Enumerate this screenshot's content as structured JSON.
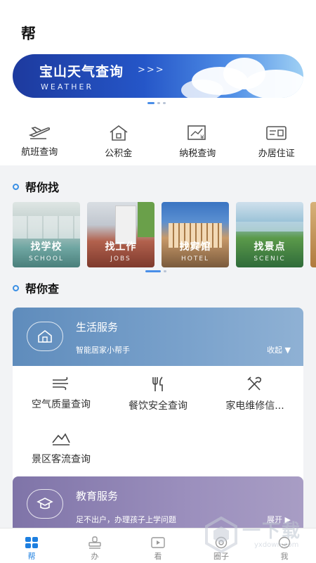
{
  "header": {
    "title": "帮"
  },
  "banner": {
    "title": "宝山天气查询",
    "arrows": ">>>",
    "subtitle": "WEATHER"
  },
  "quick_services": [
    {
      "label": "航班查询",
      "icon": "airplane-icon"
    },
    {
      "label": "公积金",
      "icon": "house-icon"
    },
    {
      "label": "纳税查询",
      "icon": "tax-chart-icon"
    },
    {
      "label": "办居住证",
      "icon": "id-card-icon"
    }
  ],
  "find_section": {
    "title": "帮你找",
    "items": [
      {
        "cn": "找学校",
        "en": "SCHOOL"
      },
      {
        "cn": "找工作",
        "en": "JOBS"
      },
      {
        "cn": "找宾馆",
        "en": "HOTEL"
      },
      {
        "cn": "找景点",
        "en": "SCENIC"
      }
    ]
  },
  "check_section": {
    "title": "帮你查"
  },
  "life_card": {
    "title": "生活服务",
    "subtitle": "智能居家小帮手",
    "collapse_label": "收起 ▼",
    "items": [
      {
        "label": "空气质量查询",
        "icon": "wind-icon"
      },
      {
        "label": "餐饮安全查询",
        "icon": "cutlery-icon"
      },
      {
        "label": "家电维修信...",
        "icon": "tools-icon"
      },
      {
        "label": "景区客流查询",
        "icon": "mountain-icon"
      }
    ]
  },
  "edu_card": {
    "title": "教育服务",
    "subtitle": "足不出户，办理孩子上学问题",
    "expand_label": "展开 ▶"
  },
  "tabs": [
    {
      "label": "帮",
      "active": true
    },
    {
      "label": "办",
      "active": false
    },
    {
      "label": "看",
      "active": false
    },
    {
      "label": "圈子",
      "active": false
    },
    {
      "label": "我",
      "active": false
    }
  ],
  "watermark": {
    "text": "一下载",
    "url": "yxdown.com"
  }
}
